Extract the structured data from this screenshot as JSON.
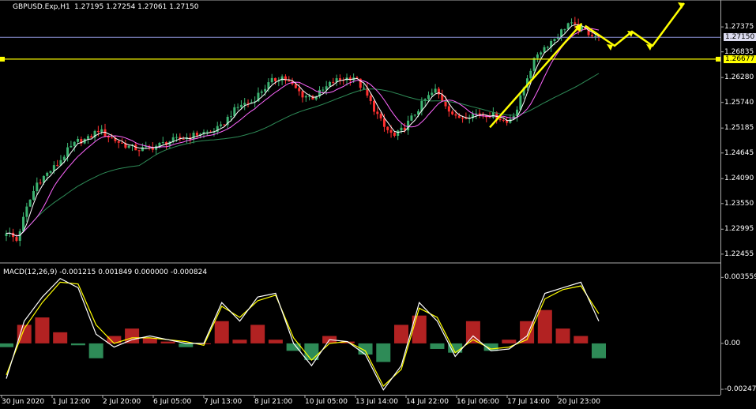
{
  "window": {
    "symbol_label": "GBPUSD.Exp,H1",
    "ohlc_label": "1.27195 1.27254 1.27061 1.27150",
    "macd_label": "MACD(12,26,9) -0.001215 0.001849 0.000000 -0.000824"
  },
  "colors": {
    "background": "#000000",
    "bull_candle": "#3cb371",
    "bear_candle": "#ff3030",
    "ma_fast": "#ffffff",
    "ma_medium": "#ff66ff",
    "ma_slow": "#2e8b57",
    "forecast_arrows": "#ffff00",
    "support_line": "#ffff00",
    "current_price_line": "#8a8fd6",
    "macd_hist_pos": "#b22222",
    "macd_hist_neg": "#2e8b57",
    "macd_line": "#ffffff",
    "signal_line": "#ffff00"
  },
  "price_levels": {
    "current_price": "1.27150",
    "support_level": "1.26677"
  },
  "chart_data": [
    {
      "type": "candlestick",
      "title": "GBPUSD.Exp,H1",
      "y_ticks": [
        "1.27375",
        "1.26835",
        "1.26280",
        "1.25740",
        "1.25185",
        "1.24645",
        "1.24090",
        "1.23550",
        "1.22995",
        "1.22455"
      ],
      "ylim": [
        1.2235,
        1.2765
      ],
      "x_ticks": [
        "30 Jun 2020",
        "1 Jul 12:00",
        "2 Jul 20:00",
        "6 Jul 05:00",
        "7 Jul 13:00",
        "8 Jul 21:00",
        "10 Jul 05:00",
        "13 Jul 14:00",
        "14 Jul 22:00",
        "16 Jul 06:00",
        "17 Jul 14:00",
        "20 Jul 23:00"
      ],
      "series": [
        {
          "name": "price path",
          "values": [
            1.2295,
            1.2275,
            1.2345,
            1.24,
            1.242,
            1.244,
            1.247,
            1.249,
            1.2495,
            1.2515,
            1.25,
            1.2488,
            1.2478,
            1.2472,
            1.2475,
            1.2482,
            1.249,
            1.2495,
            1.25,
            1.2508,
            1.251,
            1.252,
            1.255,
            1.257,
            1.2575,
            1.26,
            1.262,
            1.263,
            1.261,
            1.259,
            1.2585,
            1.26,
            1.262,
            1.2625,
            1.263,
            1.26,
            1.256,
            1.252,
            1.25,
            1.252,
            1.255,
            1.258,
            1.26,
            1.257,
            1.254,
            1.2545,
            1.255,
            1.2548,
            1.2545,
            1.253,
            1.256,
            1.263,
            1.268,
            1.27,
            1.272,
            1.2745,
            1.2735,
            1.2725,
            1.2715
          ]
        }
      ]
    },
    {
      "type": "line",
      "title": "MACD(12,26,9)",
      "y_ticks": [
        "0.003559",
        "0.00",
        "-0.002475"
      ],
      "ylim": [
        -0.0026,
        0.0037
      ],
      "series": [
        {
          "name": "MACD",
          "values": [
            -0.0019,
            0.0012,
            0.0025,
            0.0035,
            0.003,
            0.0005,
            -0.0002,
            0.0002,
            0.0004,
            0.0002,
            0.0,
            0.0,
            0.0022,
            0.0012,
            0.0025,
            0.0027,
            0.0,
            -0.0012,
            0.0002,
            0.0001,
            -0.0006,
            -0.0025,
            -0.0012,
            0.0022,
            0.0012,
            -0.0007,
            0.0004,
            -0.0004,
            -0.0003,
            0.0004,
            0.0027,
            0.003,
            0.0033,
            0.0012
          ]
        },
        {
          "name": "Signal",
          "values": [
            -0.0017,
            0.0008,
            0.0022,
            0.0033,
            0.0032,
            0.001,
            0.0,
            0.0003,
            0.0003,
            0.0002,
            0.0001,
            -0.0001,
            0.002,
            0.0014,
            0.0023,
            0.0026,
            0.0003,
            -0.0009,
            0.0,
            0.0001,
            -0.0004,
            -0.0023,
            -0.0014,
            0.0019,
            0.0014,
            -0.0005,
            0.0002,
            -0.0003,
            -0.0002,
            0.0002,
            0.0024,
            0.0029,
            0.0031,
            0.0016
          ]
        },
        {
          "name": "Histogram",
          "values": [
            -0.0002,
            0.001,
            0.0014,
            0.0006,
            -0.0001,
            -0.0008,
            0.0004,
            0.0008,
            0.0003,
            0.0001,
            -0.0002,
            0.0,
            0.0012,
            0.0002,
            0.001,
            0.0002,
            -0.0004,
            -0.0009,
            0.0004,
            0.0001,
            -0.0006,
            -0.001,
            0.001,
            0.0015,
            -0.0003,
            -0.0005,
            0.0012,
            -0.0004,
            0.0002,
            0.0012,
            0.0018,
            0.0008,
            0.0004,
            -0.0008
          ]
        }
      ]
    }
  ]
}
